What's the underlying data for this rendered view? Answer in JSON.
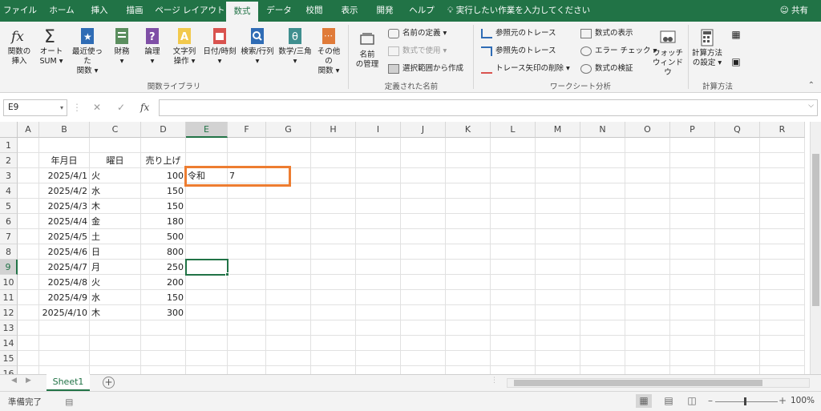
{
  "ribbon_tabs": [
    "ファイル",
    "ホーム",
    "挿入",
    "描画",
    "ページ レイアウト",
    "数式",
    "データ",
    "校閲",
    "表示",
    "開発",
    "ヘルプ"
  ],
  "tellme": "実行したい作業を入力してください",
  "share": "共有",
  "ribbon": {
    "function_library": {
      "label": "関数ライブラリ",
      "buttons": [
        {
          "line1": "関数の",
          "line2": "挿入",
          "icon": "fx-icon"
        },
        {
          "line1": "オート",
          "line2": "SUM ▾",
          "icon": "sigma-icon"
        },
        {
          "line1": "最近使った",
          "line2": "関数 ▾",
          "icon": "star-book-icon"
        },
        {
          "line1": "財務",
          "line2": "▾",
          "icon": "finance-book-icon"
        },
        {
          "line1": "論理",
          "line2": "▾",
          "icon": "logic-book-icon"
        },
        {
          "line1": "文字列",
          "line2": "操作 ▾",
          "icon": "text-book-icon"
        },
        {
          "line1": "日付/時刻",
          "line2": "▾",
          "icon": "calendar-book-icon"
        },
        {
          "line1": "検索/行列",
          "line2": "▾",
          "icon": "search-book-icon"
        },
        {
          "line1": "数学/三角",
          "line2": "▾",
          "icon": "theta-book-icon"
        },
        {
          "line1": "その他の",
          "line2": "関数 ▾",
          "icon": "more-book-icon"
        }
      ]
    },
    "defined_names": {
      "label": "定義された名前",
      "manager_line1": "名前",
      "manager_line2": "の管理",
      "define": "名前の定義 ▾",
      "use_in_formula": "数式で使用 ▾",
      "create_from_selection": "選択範囲から作成"
    },
    "formula_auditing": {
      "label": "ワークシート分析",
      "trace_precedents": "参照元のトレース",
      "trace_dependents": "参照先のトレース",
      "remove_arrows": "トレース矢印の削除 ▾",
      "show_formulas": "数式の表示",
      "error_check": "エラー チェック ▾",
      "evaluate": "数式の検証",
      "watch_line1": "ウォッチ",
      "watch_line2": "ウィンドウ"
    },
    "calculation": {
      "label": "計算方法",
      "options_line1": "計算方法",
      "options_line2": "の設定 ▾"
    }
  },
  "formula_bar": {
    "name_box": "E9",
    "cancel": "✕",
    "enter": "✓",
    "fx": "fx",
    "value": ""
  },
  "columns": [
    "A",
    "B",
    "C",
    "D",
    "E",
    "F",
    "G",
    "H",
    "I",
    "J",
    "K",
    "L",
    "M",
    "N",
    "O",
    "P",
    "Q",
    "R"
  ],
  "rows": [
    "1",
    "2",
    "3",
    "4",
    "5",
    "6",
    "7",
    "8",
    "9",
    "10",
    "11",
    "12",
    "13",
    "14",
    "15",
    "16"
  ],
  "cells": {
    "B2": "年月日",
    "C2": "曜日",
    "D2": "売り上げ",
    "B3": "2025/4/1",
    "C3": "火",
    "D3": "100",
    "E3": "令和",
    "F3": "7",
    "B4": "2025/4/2",
    "C4": "水",
    "D4": "150",
    "B5": "2025/4/3",
    "C5": "木",
    "D5": "150",
    "B6": "2025/4/4",
    "C6": "金",
    "D6": "180",
    "B7": "2025/4/5",
    "C7": "土",
    "D7": "500",
    "B8": "2025/4/6",
    "C8": "日",
    "D8": "800",
    "B9": "2025/4/7",
    "C9": "月",
    "D9": "250",
    "B10": "2025/4/8",
    "C10": "火",
    "D10": "200",
    "B11": "2025/4/9",
    "C11": "水",
    "D11": "150",
    "B12": "2025/4/10",
    "C12": "木",
    "D12": "300"
  },
  "selected_cell": "E9",
  "highlight_color": "#ed7d31",
  "accent_color": "#217346",
  "sheet_tab": "Sheet1",
  "status": "準備完了",
  "zoom": "100%"
}
